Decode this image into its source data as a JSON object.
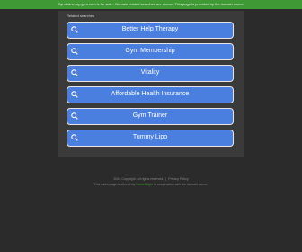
{
  "banner": {
    "text": "Gymtrainer.sy-gym.com is for sale - Domain related searches are shown. This page is provided by the domain owner."
  },
  "panel": {
    "heading": "Related searches"
  },
  "links": [
    {
      "label": "Better Help Therapy",
      "icon": "search-icon"
    },
    {
      "label": "Gym Membership",
      "icon": "search-icon"
    },
    {
      "label": "Vitality",
      "icon": "search-icon"
    },
    {
      "label": "Affordable Health Insurance",
      "icon": "search-icon"
    },
    {
      "label": "Gym Trainer",
      "icon": "search-icon"
    },
    {
      "label": "Tummy Lipo",
      "icon": "search-icon"
    }
  ],
  "footer": {
    "copyright": "2024 Copyright. All rights reserved.",
    "privacy_link": "Privacy Policy",
    "notice_prefix": "This sales page is offered by",
    "notice_link": "NameBright",
    "notice_suffix": "in cooperation with the domain owner."
  },
  "colors": {
    "banner_bg": "#3f9a36",
    "page_bg": "#2b2b2b",
    "panel_bg": "#3a3a3a",
    "button_bg": "#4a7fe0",
    "button_border": "#e6e6e6"
  }
}
